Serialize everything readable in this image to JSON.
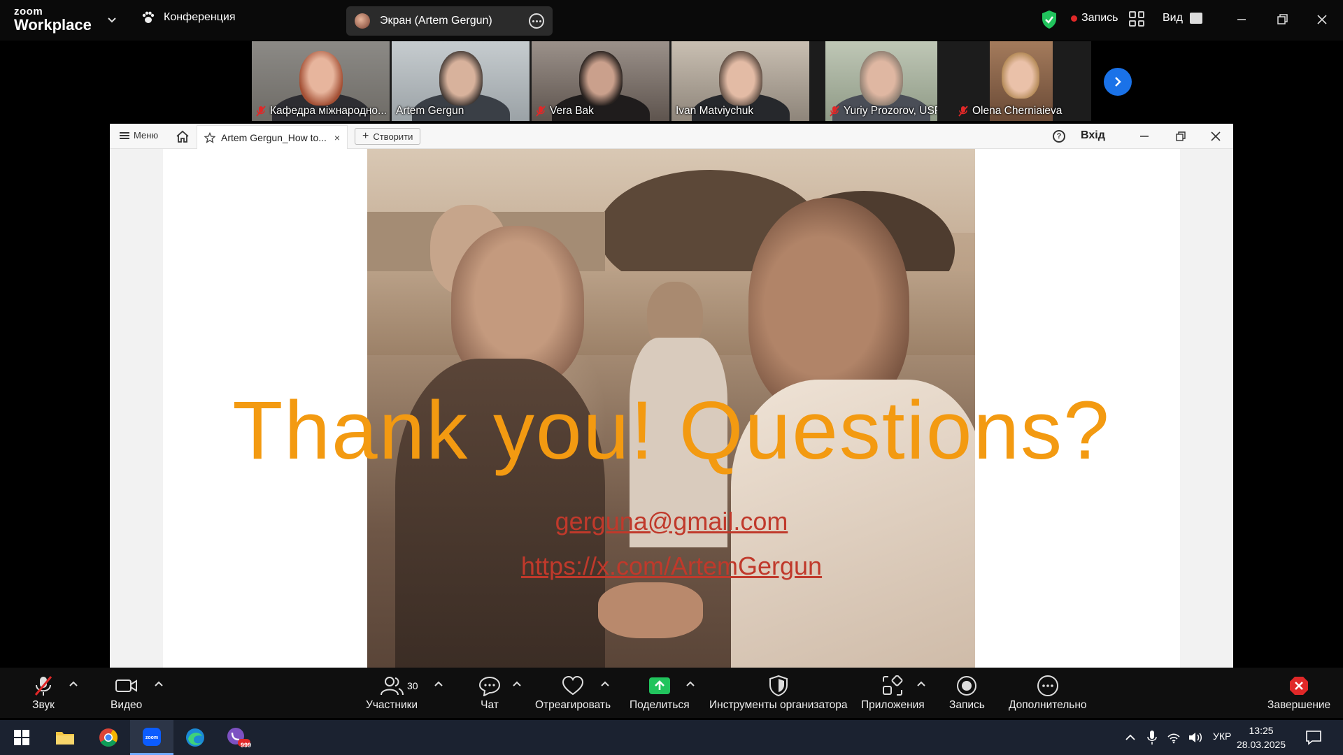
{
  "app": {
    "brand_top": "zoom",
    "brand_bottom": "Workplace",
    "meeting_label": "Конференция",
    "screen_label": "Экран (Artem Gergun)",
    "recording_label": "Запись",
    "view_label": "Вид"
  },
  "participants": [
    {
      "name": "Кафедра міжнародно...",
      "muted": true
    },
    {
      "name": "Artem Gergun",
      "muted": false
    },
    {
      "name": "Vera Bak",
      "muted": true
    },
    {
      "name": "Ivan Matviychuk",
      "muted": false,
      "speaking": true
    },
    {
      "name": "Yuriy Prozorov, USFA",
      "muted": true
    },
    {
      "name": "Olena Cherniaieva",
      "muted": true
    }
  ],
  "shared_window": {
    "menu_label": "Меню",
    "tab_title": "Artem Gergun_How to...",
    "tab_close": "×",
    "new_label": "Створити",
    "help": "?",
    "login_label": "Вхід",
    "slide": {
      "title": "Thank you! Questions?",
      "email": "gerguna@gmail.com",
      "link": "https://x.com/ArtemGergun"
    }
  },
  "toolbar": {
    "audio": "Звук",
    "video": "Видео",
    "participants": "Участники",
    "participants_count": "30",
    "chat": "Чат",
    "react": "Отреагировать",
    "share": "Поделиться",
    "host_tools": "Инструменты организатора",
    "apps": "Приложения",
    "record": "Запись",
    "more": "Дополнительно",
    "end": "Завершение"
  },
  "taskbar": {
    "viber_badge": "999",
    "language": "УКР",
    "time": "13:25",
    "date": "28.03.2025"
  },
  "colors": {
    "accent_blue": "#1a72e8",
    "active_speaker": "#21c45d",
    "slide_title": "#f39a11",
    "slide_link": "#c0392b",
    "end_red": "#e02828"
  }
}
